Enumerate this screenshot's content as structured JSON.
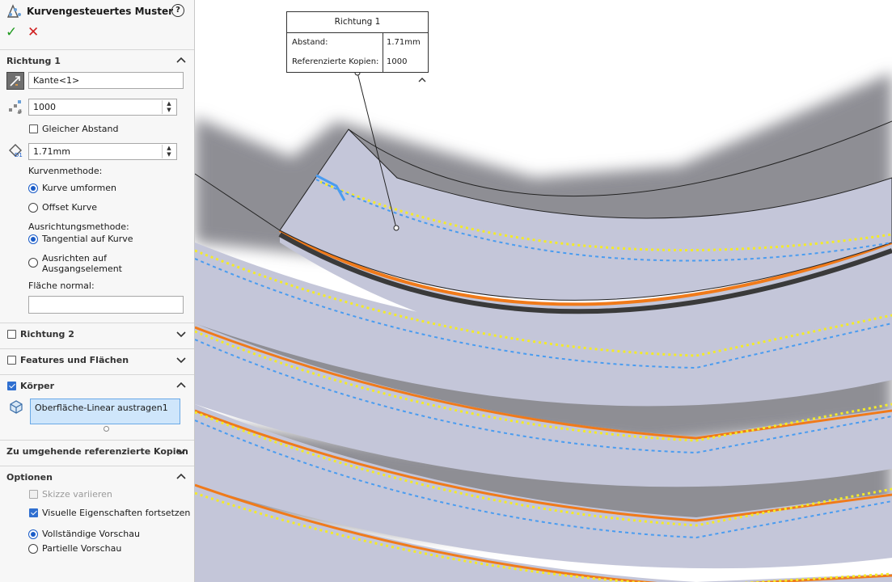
{
  "panel": {
    "title": "Kurvengesteuertes Muster",
    "help_label": "?",
    "ok_label": "✓",
    "cancel_label": "✕",
    "richtung1": {
      "label": "Richtung 1",
      "edge_value": "Kante<1>",
      "count_value": "1000",
      "equal_spacing_label": "Gleicher Abstand",
      "spacing_value": "1.71mm",
      "curve_method_label": "Kurvenmethode:",
      "curve_options": [
        "Kurve umformen",
        "Offset Kurve"
      ],
      "curve_selected": 0,
      "align_method_label": "Ausrichtungsmethode:",
      "align_options": [
        "Tangential auf Kurve",
        "Ausrichten auf\nAusgangselement"
      ],
      "align_option_line1": "Ausrichten auf",
      "align_option_line2": "Ausgangselement",
      "align_selected": 0,
      "face_normal_label": "Fläche normal:",
      "face_normal_value": ""
    },
    "richtung2": {
      "label": "Richtung 2",
      "checked": false
    },
    "features": {
      "label": "Features und Flächen",
      "checked": false
    },
    "koerper": {
      "label": "Körper",
      "checked": true,
      "body_item": "Oberfläche-Linear austragen1"
    },
    "skip": {
      "label": "Zu umgehende referenzierte Kopien"
    },
    "optionen": {
      "label": "Optionen",
      "vary_sketch": "Skizze variieren",
      "vary_sketch_checked": false,
      "propagate_visual": "Visuelle Eigenschaften fortsetzen",
      "propagate_visual_checked": true,
      "preview_options": [
        "Vollständige Vorschau",
        "Partielle Vorschau"
      ],
      "preview_selected": 0
    }
  },
  "callout": {
    "title": "Richtung 1",
    "rows": [
      {
        "label": "Abstand:",
        "value": "1.71mm"
      },
      {
        "label": "Referenzierte Kopien:",
        "value": "1000"
      }
    ]
  },
  "colors": {
    "surface": "#c4c6d9",
    "shadow": "#8e8e94",
    "edge_orange": "#f07a1a",
    "preview_yellow": "#f3ea2a",
    "preview_blue_dash": "#4a9cf0",
    "accent_blue": "#1a5cc8"
  }
}
